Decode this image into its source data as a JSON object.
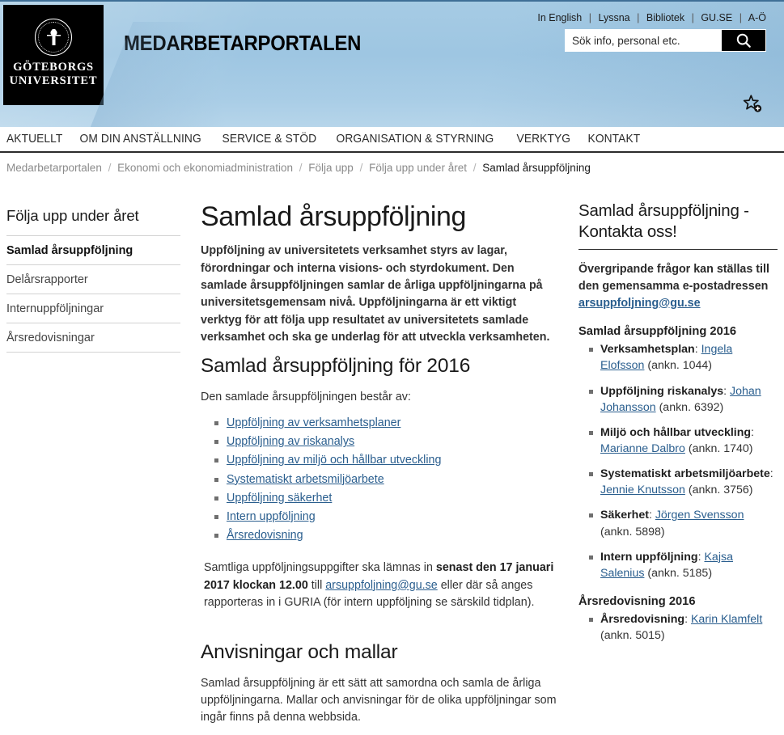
{
  "header": {
    "logo": {
      "line1": "GÖTEBORGS",
      "line2": "UNIVERSITET",
      "seal_alt": "university-seal"
    },
    "site_title": "MEDARBETARPORTALEN",
    "top_links": [
      {
        "label": "In English"
      },
      {
        "label": "Lyssna"
      },
      {
        "label": "Bibliotek"
      },
      {
        "label": "GU.SE"
      },
      {
        "label": "A-Ö"
      }
    ],
    "separator": "|",
    "search": {
      "placeholder": "Sök info, personal etc.",
      "value": "",
      "button_icon": "search-icon"
    },
    "bookmark_icon": "star-add-icon",
    "background_color": "#a6cbe4"
  },
  "mainnav": {
    "items": [
      {
        "label": "AKTUELLT"
      },
      {
        "label": "OM DIN ANSTÄLLNING"
      },
      {
        "label": "SERVICE & STÖD"
      },
      {
        "label": "ORGANISATION & STYRNING"
      },
      {
        "label": "VERKTYG"
      },
      {
        "label": "KONTAKT"
      }
    ]
  },
  "breadcrumb": {
    "separator": "/",
    "items": [
      {
        "label": "Medarbetarportalen",
        "current": false
      },
      {
        "label": "Ekonomi och ekonomiadministration",
        "current": false
      },
      {
        "label": "Följa upp",
        "current": false
      },
      {
        "label": "Följa upp under året",
        "current": false
      },
      {
        "label": "Samlad årsuppföljning",
        "current": true
      }
    ]
  },
  "sidebar": {
    "title": "Följa upp under året",
    "items": [
      {
        "label": "Samlad årsuppföljning",
        "active": true
      },
      {
        "label": "Delårsrapporter",
        "active": false
      },
      {
        "label": "Internuppföljningar",
        "active": false
      },
      {
        "label": "Årsredovisningar",
        "active": false
      }
    ]
  },
  "main": {
    "title": "Samlad årsuppföljning",
    "lead": "Uppföljning av universitetets verksamhet styrs av lagar, förordningar och interna visions- och styrdokument. Den samlade årsuppföljningen samlar de årliga uppföljningarna på universitetsgemensam nivå. Uppföljningarna är ett viktigt verktyg för att följa upp resultatet av universitetets samlade verksamhet och ska ge underlag för att utveckla verksamheten.",
    "section1": {
      "heading": "Samlad årsuppföljning för 2016",
      "intro": "Den samlade årsuppföljningen består av:",
      "links": [
        {
          "label": "Uppföljning av verksamhetsplaner"
        },
        {
          "label": "Uppföljning av riskanalys"
        },
        {
          "label": "Uppföljning av miljö och hållbar utveckling"
        },
        {
          "label": "Systematiskt arbetsmiljöarbete"
        },
        {
          "label": "Uppföljning säkerhet"
        },
        {
          "label": "Intern uppföljning"
        },
        {
          "label": "Årsredovisning"
        }
      ],
      "deadline_part1": " Samtliga uppföljningsuppgifter ska lämnas in ",
      "deadline_bold": "senast den 17 januari 2017 klockan 12.00",
      "deadline_part2": " till ",
      "deadline_email": "arsuppfoljning@gu.se",
      "deadline_part3": " eller där så anges rapporteras in i GURIA (för intern uppföljning se särskild tidplan)."
    },
    "section2": {
      "heading": "Anvisningar och mallar",
      "body": "Samlad årsuppföljning är ett sätt att samordna och samla de årliga uppföljningarna. Mallar och anvisningar för de olika uppföljningar som ingår finns på denna webbsida."
    }
  },
  "rightcol": {
    "box_title": "Samlad årsuppföljning - Kontakta oss!",
    "box_lead_text": "Övergripande frågor kan ställas till den gemensamma e-postadressen ",
    "box_lead_email": "arsuppfoljning@gu.se",
    "group1": {
      "heading": "Samlad årsuppföljning 2016",
      "contacts": [
        {
          "role": "Verksamhetsplan",
          "name": "Ingela Elofsson",
          "ext": "(ankn. 1044)"
        },
        {
          "role": "Uppföljning riskanalys",
          "name": "Johan Johansson",
          "ext": "(ankn. 6392)"
        },
        {
          "role": "Miljö och hållbar utveckling",
          "name": "Marianne Dalbro",
          "ext": "(ankn. 1740)"
        },
        {
          "role": "Systematiskt arbetsmiljöarbete",
          "name": "Jennie Knutsson",
          "ext": "(ankn. 3756)"
        },
        {
          "role": "Säkerhet",
          "name": "Jörgen Svensson",
          "ext": "(ankn. 5898)"
        },
        {
          "role": "Intern uppföljning",
          "name": "Kajsa Salenius",
          "ext": "(ankn. 5185)"
        }
      ]
    },
    "group2": {
      "heading": "Årsredovisning 2016",
      "contacts": [
        {
          "role": "Årsredovisning",
          "name": "Karin Klamfelt",
          "ext": "(ankn. 5015)"
        }
      ]
    },
    "link_color": "#2a5e8e"
  }
}
